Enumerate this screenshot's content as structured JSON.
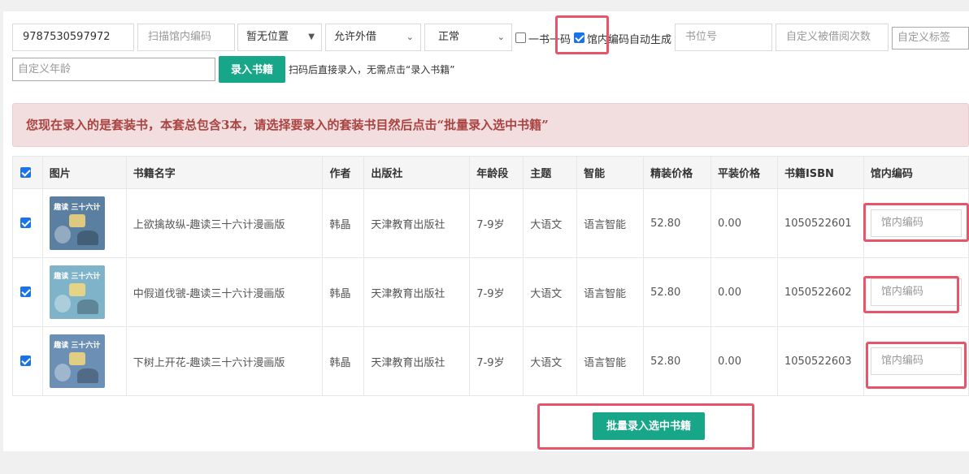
{
  "form": {
    "isbn_value": "9787530597972",
    "scan_placeholder": "扫描馆内编码",
    "location_select": "暂无位置",
    "lend_select": "允许外借",
    "status_select": "正常",
    "one_book_one_code_label": "一书一码",
    "auto_code_label": "馆内编码自动生成",
    "shelf_placeholder": "书位号",
    "borrow_count_placeholder": "自定义被借阅次数",
    "tag_placeholder": "自定义标签",
    "age_placeholder": "自定义年龄",
    "submit_button": "录入书籍",
    "hint": "扫码后直接录入，无需点击“录入书籍”"
  },
  "alert": "您现在录入的是套装书，本套总包含3本，请选择要录入的套装书目然后点击“批量录入选中书籍”",
  "table": {
    "headers": [
      "图片",
      "书籍名字",
      "作者",
      "出版社",
      "年龄段",
      "主题",
      "智能",
      "精装价格",
      "平装价格",
      "书籍ISBN",
      "馆内编码"
    ],
    "rows": [
      {
        "title": "上欲擒故纵-趣读三十六计漫画版",
        "author": "韩晶",
        "publisher": "天津教育出版社",
        "age": "7-9岁",
        "theme": "大语文",
        "intel": "语言智能",
        "hard_price": "52.80",
        "soft_price": "0.00",
        "isbn": "1050522601",
        "code_placeholder": "馆内编码",
        "cover_title": "趣读 三十六计",
        "cover_color": "#5a7fa0"
      },
      {
        "title": "中假道伐虢-趣读三十六计漫画版",
        "author": "韩晶",
        "publisher": "天津教育出版社",
        "age": "7-9岁",
        "theme": "大语文",
        "intel": "语言智能",
        "hard_price": "52.80",
        "soft_price": "0.00",
        "isbn": "1050522602",
        "code_placeholder": "馆内编码",
        "cover_title": "趣读 三十六计",
        "cover_color": "#7fb3c9"
      },
      {
        "title": "下树上开花-趣读三十六计漫画版",
        "author": "韩晶",
        "publisher": "天津教育出版社",
        "age": "7-9岁",
        "theme": "大语文",
        "intel": "语言智能",
        "hard_price": "52.80",
        "soft_price": "0.00",
        "isbn": "1050522603",
        "code_placeholder": "馆内编码",
        "cover_title": "趣读 三十六计",
        "cover_color": "#6c8fb5"
      }
    ]
  },
  "batch_button": "批量录入选中书籍",
  "colors": {
    "accent": "#18a689",
    "highlight": "#e8556a",
    "alert_text": "#a94442",
    "checkbox": "#1a73e8"
  }
}
